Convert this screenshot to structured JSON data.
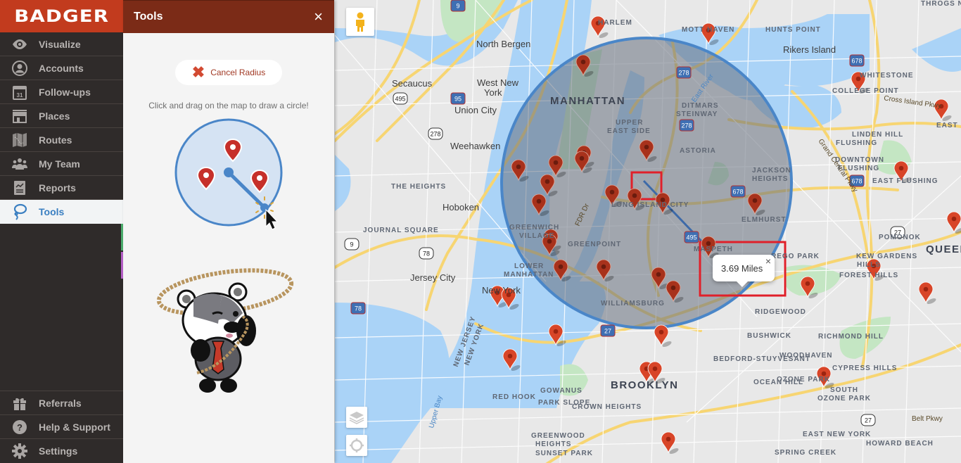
{
  "app": {
    "logo": "BADGER"
  },
  "sidebar": {
    "items": [
      {
        "label": "Visualize",
        "icon": "eye-icon"
      },
      {
        "label": "Accounts",
        "icon": "account-circle-icon"
      },
      {
        "label": "Follow-ups",
        "icon": "calendar-icon",
        "icon_text": "31"
      },
      {
        "label": "Places",
        "icon": "storefront-icon"
      },
      {
        "label": "Routes",
        "icon": "map-icon"
      },
      {
        "label": "My Team",
        "icon": "team-icon"
      },
      {
        "label": "Reports",
        "icon": "report-icon"
      },
      {
        "label": "Tools",
        "icon": "lasso-icon",
        "active": true
      }
    ],
    "bottom_items": [
      {
        "label": "Referrals",
        "icon": "gift-icon"
      },
      {
        "label": "Help & Support",
        "icon": "help-icon"
      },
      {
        "label": "Settings",
        "icon": "gear-icon"
      }
    ],
    "strip_colors": [
      "#4caf6e",
      "#b760c9"
    ]
  },
  "tools_panel": {
    "title": "Tools",
    "close_label": "×",
    "cancel_button": "Cancel Radius",
    "hint": "Click and drag on the map to draw a circle!"
  },
  "map": {
    "popup": {
      "text": "3.69 Miles",
      "close": "×"
    },
    "radius_miles": 3.69,
    "colors": {
      "circle_stroke": "#4a86c8",
      "pin": "#d84528",
      "pin_inside": "#a8321c",
      "highlight_box": "#e0202a"
    },
    "labels": [
      {
        "text": "North Bergen",
        "kind": "city"
      },
      {
        "text": "Secaucus",
        "kind": "city"
      },
      {
        "text": "West New",
        "kind": "city"
      },
      {
        "text": "York",
        "kind": "city"
      },
      {
        "text": "Union City",
        "kind": "city"
      },
      {
        "text": "Weehawken",
        "kind": "city"
      },
      {
        "text": "Hoboken",
        "kind": "city"
      },
      {
        "text": "Jersey City",
        "kind": "city"
      },
      {
        "text": "New York",
        "kind": "city"
      },
      {
        "text": "Rikers Island",
        "kind": "city"
      },
      {
        "text": "MANHATTAN",
        "kind": "big"
      },
      {
        "text": "BROOKLYN",
        "kind": "big"
      },
      {
        "text": "QUEENS",
        "kind": "big"
      },
      {
        "text": "HARLEM",
        "kind": "area"
      },
      {
        "text": "MOTT HAVEN",
        "kind": "area"
      },
      {
        "text": "HUNTS POINT",
        "kind": "area"
      },
      {
        "text": "THROGS NECK",
        "kind": "area"
      },
      {
        "text": "WHITESTONE",
        "kind": "area"
      },
      {
        "text": "COLLEGE POINT",
        "kind": "area"
      },
      {
        "text": "UPPER",
        "kind": "area"
      },
      {
        "text": "EAST SIDE",
        "kind": "area"
      },
      {
        "text": "DITMARS",
        "kind": "area"
      },
      {
        "text": "STEINWAY",
        "kind": "area"
      },
      {
        "text": "ASTORIA",
        "kind": "area"
      },
      {
        "text": "EAST ELMHURST",
        "kind": "area"
      },
      {
        "text": "LINDEN HILL",
        "kind": "area"
      },
      {
        "text": "FLUSHING",
        "kind": "area"
      },
      {
        "text": "DOWNTOWN",
        "kind": "area"
      },
      {
        "text": "FLUSHING",
        "kind": "area"
      },
      {
        "text": "EAST FLUSHING",
        "kind": "area"
      },
      {
        "text": "JACKSON",
        "kind": "area"
      },
      {
        "text": "HEIGHTS",
        "kind": "area"
      },
      {
        "text": "THE HEIGHTS",
        "kind": "area"
      },
      {
        "text": "JOURNAL SQUARE",
        "kind": "area"
      },
      {
        "text": "GREENWICH",
        "kind": "area"
      },
      {
        "text": "VILLAGE",
        "kind": "area"
      },
      {
        "text": "LONG ISLAND CITY",
        "kind": "area"
      },
      {
        "text": "ELMHURST",
        "kind": "area"
      },
      {
        "text": "GREENPOINT",
        "kind": "area"
      },
      {
        "text": "MASPETH",
        "kind": "area"
      },
      {
        "text": "REGO PARK",
        "kind": "area"
      },
      {
        "text": "POMONOK",
        "kind": "area"
      },
      {
        "text": "KEW GARDENS",
        "kind": "area"
      },
      {
        "text": "HILLS",
        "kind": "area"
      },
      {
        "text": "FOREST HILLS",
        "kind": "area"
      },
      {
        "text": "LOWER",
        "kind": "area"
      },
      {
        "text": "MANHATTAN",
        "kind": "area"
      },
      {
        "text": "WILLIAMSBURG",
        "kind": "area"
      },
      {
        "text": "RIDGEWOOD",
        "kind": "area"
      },
      {
        "text": "BUSHWICK",
        "kind": "area"
      },
      {
        "text": "BEDFORD-STUYVESANT",
        "kind": "area"
      },
      {
        "text": "OCEAN HILL",
        "kind": "area"
      },
      {
        "text": "CYPRESS HILLS",
        "kind": "area"
      },
      {
        "text": "WOODHAVEN",
        "kind": "area"
      },
      {
        "text": "RICHMOND HILL",
        "kind": "area"
      },
      {
        "text": "OZONE PARK",
        "kind": "area"
      },
      {
        "text": "SOUTH",
        "kind": "area"
      },
      {
        "text": "OZONE PARK",
        "kind": "area"
      },
      {
        "text": "GOWANUS",
        "kind": "area"
      },
      {
        "text": "PARK SLOPE",
        "kind": "area"
      },
      {
        "text": "CROWN HEIGHTS",
        "kind": "area"
      },
      {
        "text": "RED HOOK",
        "kind": "area"
      },
      {
        "text": "GREENWOOD",
        "kind": "area"
      },
      {
        "text": "HEIGHTS",
        "kind": "area"
      },
      {
        "text": "SUNSET PARK",
        "kind": "area"
      },
      {
        "text": "EAST NEW YORK",
        "kind": "area"
      },
      {
        "text": "SPRING CREEK",
        "kind": "area"
      },
      {
        "text": "HOWARD BEACH",
        "kind": "area"
      },
      {
        "text": "NEW JERSEY",
        "kind": "area"
      },
      {
        "text": "NEW YORK",
        "kind": "area"
      },
      {
        "text": "Upper Bay",
        "kind": "water"
      },
      {
        "text": "East River",
        "kind": "water"
      },
      {
        "text": "FDR Dr",
        "kind": "road"
      },
      {
        "text": "Grand Central Pkwy",
        "kind": "road"
      },
      {
        "text": "Cross Island Pkwy",
        "kind": "road"
      },
      {
        "text": "Belt Pkwy",
        "kind": "road"
      }
    ],
    "shields": [
      "95",
      "9",
      "495",
      "278",
      "278",
      "278",
      "678",
      "678",
      "678",
      "78",
      "78",
      "495",
      "9",
      "27",
      "27",
      "27"
    ]
  }
}
